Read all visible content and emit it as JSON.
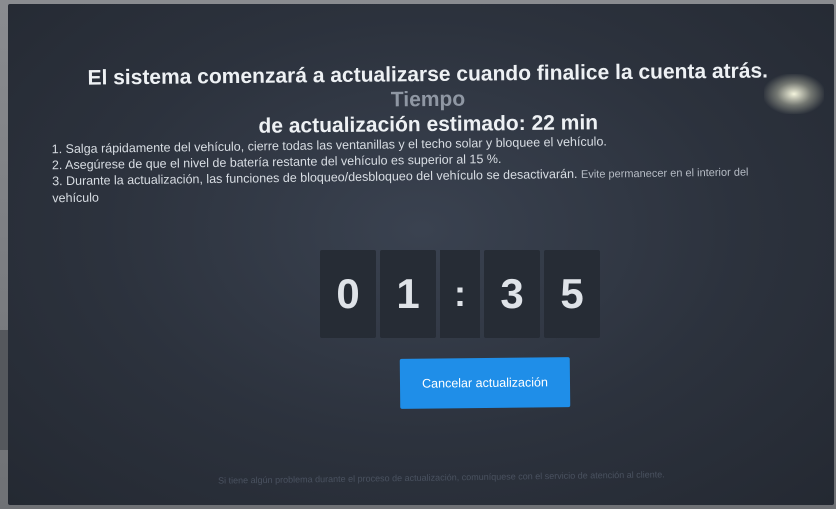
{
  "dialog": {
    "title_main": "El sistema comenzará a actualizarse cuando finalice la cuenta atrás.",
    "title_faded": "Tiempo",
    "title_line2": "de actualización estimado:  22 min"
  },
  "instructions": {
    "line1": "1. Salga rápidamente del vehículo, cierre todas las ventanillas y el techo solar y bloquee el vehículo.",
    "line2": "2. Asegúrese de que el nivel de batería restante del vehículo es superior al 15 %.",
    "line3_main": "3. Durante la actualización, las funciones de bloqueo/desbloqueo del vehículo se desactivarán.",
    "line3_dim": "Evite permanecer en el interior del",
    "line3_end": "vehículo"
  },
  "countdown": {
    "digit1": "0",
    "digit2": "1",
    "separator": ":",
    "digit3": "3",
    "digit4": "5"
  },
  "buttons": {
    "cancel": "Cancelar actualización"
  },
  "footer": {
    "text": "Si tiene algún problema durante el proceso de actualización, comuníquese con el servicio de atención al cliente."
  }
}
